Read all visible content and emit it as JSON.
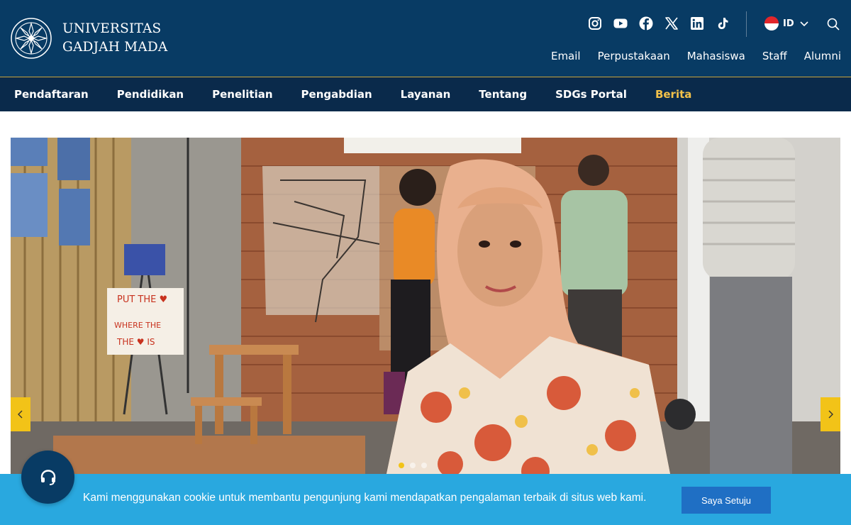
{
  "header": {
    "university_line1": "UNIVERSITAS",
    "university_line2": "GADJAH MADA",
    "socials": [
      "instagram-icon",
      "youtube-icon",
      "facebook-icon",
      "x-icon",
      "linkedin-icon",
      "tiktok-icon"
    ],
    "language": "ID",
    "quick_links": [
      "Email",
      "Perpustakaan",
      "Mahasiswa",
      "Staff",
      "Alumni"
    ]
  },
  "nav": {
    "items": [
      "Pendaftaran",
      "Pendidikan",
      "Penelitian",
      "Pengabdian",
      "Layanan",
      "Tentang",
      "SDGs Portal",
      "Berita"
    ],
    "active": "Berita"
  },
  "hero": {
    "sign_text": "PUT THE ♥ WHERE THE THE ♥ IS",
    "slide_count": 3,
    "active_slide": 1
  },
  "cookie": {
    "message": "Kami menggunakan cookie untuk membantu pengunjung kami mendapatkan pengalaman terbaik di situs web kami.",
    "button_label": "Saya Setuju"
  },
  "colors": {
    "header_bg": "#083b64",
    "nav_bg": "#0a2a4b",
    "active_nav": "#f2c14a",
    "accent_yellow": "#f2c318",
    "cookie_bg": "#29a8df",
    "cookie_button": "#1f6fc4"
  }
}
